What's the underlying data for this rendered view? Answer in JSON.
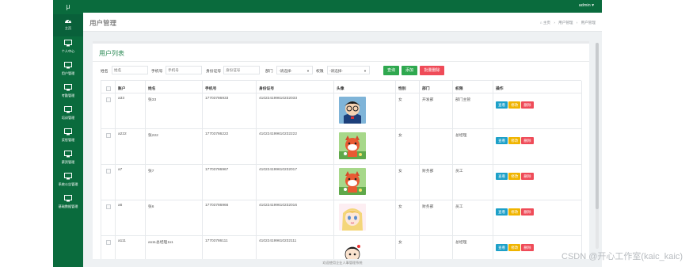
{
  "sidebar": {
    "logo": "μ",
    "items": [
      {
        "label": "主页",
        "icon": "dashboard-icon"
      },
      {
        "label": "个人中心",
        "icon": "monitor-icon"
      },
      {
        "label": "用户管理",
        "icon": "monitor-icon"
      },
      {
        "label": "考勤管理",
        "icon": "monitor-icon"
      },
      {
        "label": "培训管理",
        "icon": "monitor-icon"
      },
      {
        "label": "奖惩管理",
        "icon": "monitor-icon"
      },
      {
        "label": "薪资管理",
        "icon": "monitor-icon"
      },
      {
        "label": "系统公告管理",
        "icon": "monitor-icon"
      },
      {
        "label": "基础数据管理",
        "icon": "monitor-icon"
      }
    ]
  },
  "topbar": {
    "admin_label": "admin ▾"
  },
  "titlebar": {
    "title": "用户管理",
    "breadcrumb": [
      "⌂ 主页",
      "›",
      "用户管理",
      "›",
      "用户管理"
    ]
  },
  "card": {
    "title": "用户列表",
    "filters": {
      "name_label": "姓名",
      "name_placeholder": "姓名",
      "phone_label": "手机号",
      "phone_placeholder": "手机号",
      "id_label": "身份证号",
      "id_placeholder": "身份证号",
      "dept_label": "部门",
      "dept_value": "-请选择-",
      "perm_label": "权限",
      "perm_value": "-请选择-"
    },
    "buttons": {
      "search": "查询",
      "add": "添加",
      "batch_delete": "批量删除"
    }
  },
  "table": {
    "headers": [
      "",
      "账户",
      "姓名",
      "手机号",
      "身份证号",
      "头像",
      "性别",
      "部门",
      "权限",
      "操作"
    ],
    "rows": [
      {
        "account": "a33",
        "name": "张33",
        "phone": "17703786933",
        "idcard": "410224199610232033",
        "avatar": "conan",
        "gender": "女",
        "dept": "开发部",
        "role": "部门主管"
      },
      {
        "account": "a222",
        "name": "张222",
        "phone": "17703786222",
        "idcard": "410224199610232222",
        "avatar": "cat",
        "gender": "女",
        "dept": "",
        "role": "总经理"
      },
      {
        "account": "a7",
        "name": "张7",
        "phone": "17703786967",
        "idcard": "410224199610232017",
        "avatar": "cat",
        "gender": "女",
        "dept": "财务部",
        "role": "员工"
      },
      {
        "account": "a6",
        "name": "张6",
        "phone": "17703786966",
        "idcard": "410224199610232016",
        "avatar": "girl",
        "gender": "女",
        "dept": "财务部",
        "role": "员工"
      },
      {
        "account": "a111",
        "name": "a111总经理111",
        "phone": "17703786111",
        "idcard": "410224199610232111",
        "avatar": "boy",
        "gender": "女",
        "dept": "",
        "role": "总经理"
      }
    ],
    "ops": {
      "view": "查看",
      "edit": "修改",
      "delete": "删除"
    }
  },
  "footer": "欢迎使用企业人事管理系统",
  "watermark": "CSDN @开心工作室(kaic_kaic)",
  "colors": {
    "sidebar": "#0a6b3d",
    "accent": "#2e8b57",
    "danger": "#ef4b58",
    "info": "#1da0c8",
    "warning": "#f0b400"
  }
}
